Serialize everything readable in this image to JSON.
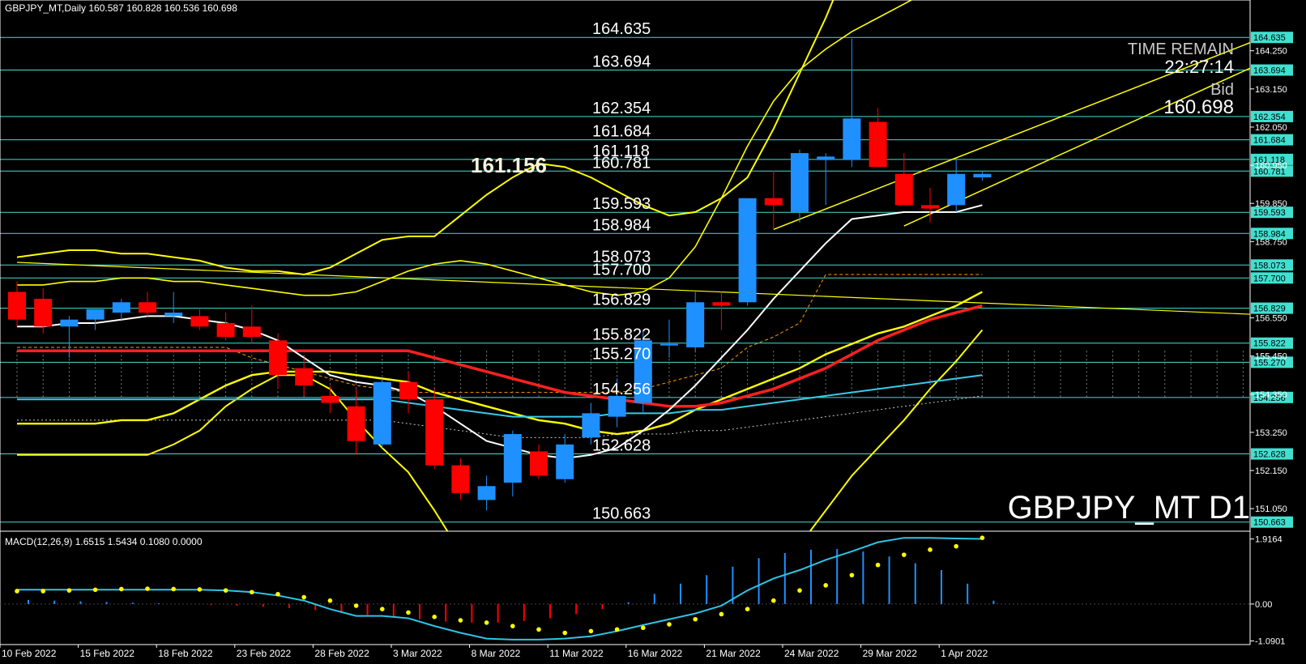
{
  "header": {
    "symbol_info": "GBPJPY_MT,Daily  160.587 160.828 160.536 160.698"
  },
  "watermark": "GBPJPY_MT D1",
  "timer": {
    "title": "TIME REMAIN",
    "value": "22:27:14",
    "bid_label": "Bid",
    "bid_value": "160.698"
  },
  "big_label": "161.156",
  "macd_label": "MACD(12,26,9) 1.6515 1.5434 0.1080 0.0000",
  "colors": {
    "up": "#1e90ff",
    "down": "#ff0000",
    "level": "#40e0d0",
    "band": "#ffff00",
    "ma_red": "#ff2020",
    "ma_white": "#ffffff",
    "macd_line": "#2ec4e6",
    "signal": "#ffff00"
  },
  "chart_data": {
    "type": "candlestick",
    "title": "GBPJPY_MT,Daily",
    "ylim": [
      150.4,
      165.2
    ],
    "macd_ylim": [
      -1.1,
      2.05
    ],
    "x_labels": [
      "10 Feb 2022",
      "15 Feb 2022",
      "18 Feb 2022",
      "23 Feb 2022",
      "28 Feb 2022",
      "3 Mar 2022",
      "8 Mar 2022",
      "11 Mar 2022",
      "16 Mar 2022",
      "21 Mar 2022",
      "24 Mar 2022",
      "29 Mar 2022",
      "1 Apr 2022"
    ],
    "x_label_index": [
      0,
      3,
      6,
      9,
      12,
      15,
      18,
      21,
      24,
      27,
      30,
      33,
      36
    ],
    "y_axis_labels": [
      "164.250",
      "163.150",
      "162.050",
      "160.950",
      "159.850",
      "158.750",
      "156.550",
      "155.450",
      "154.350",
      "153.250",
      "152.150",
      "151.050"
    ],
    "macd_axis_labels": [
      "1.9164",
      "0.00",
      "-1.0901"
    ],
    "levels": [
      {
        "value": 164.635,
        "label": "164.635"
      },
      {
        "value": 163.694,
        "label": "163.694"
      },
      {
        "value": 162.354,
        "label": "162.354"
      },
      {
        "value": 161.684,
        "label": "161.684"
      },
      {
        "value": 161.118,
        "label": "161.118"
      },
      {
        "value": 160.781,
        "label": "160.781"
      },
      {
        "value": 159.593,
        "label": "159.593"
      },
      {
        "value": 158.984,
        "label": "158.984"
      },
      {
        "value": 158.073,
        "label": "158.073"
      },
      {
        "value": 157.7,
        "label": "157.700"
      },
      {
        "value": 156.829,
        "label": "156.829"
      },
      {
        "value": 155.822,
        "label": "155.822"
      },
      {
        "value": 155.27,
        "label": "155.270"
      },
      {
        "value": 154.256,
        "label": "154.256"
      },
      {
        "value": 152.628,
        "label": "152.628"
      },
      {
        "value": 150.663,
        "label": "150.663"
      }
    ],
    "candles": [
      [
        157.3,
        157.6,
        156.3,
        156.5
      ],
      [
        157.1,
        157.4,
        156.1,
        156.3
      ],
      [
        156.3,
        156.6,
        155.4,
        156.5
      ],
      [
        156.5,
        156.8,
        156.2,
        156.8
      ],
      [
        156.7,
        157.1,
        156.5,
        157.0
      ],
      [
        157.0,
        157.3,
        156.6,
        156.7
      ],
      [
        156.6,
        157.3,
        156.4,
        156.7
      ],
      [
        156.6,
        156.8,
        156.2,
        156.3
      ],
      [
        156.4,
        156.7,
        155.9,
        156.0
      ],
      [
        156.3,
        156.9,
        155.8,
        156.0
      ],
      [
        155.9,
        156.1,
        154.5,
        154.9
      ],
      [
        155.1,
        155.4,
        154.3,
        154.6
      ],
      [
        154.3,
        154.6,
        153.8,
        154.1
      ],
      [
        154.0,
        154.5,
        152.6,
        153.0
      ],
      [
        152.9,
        154.8,
        152.8,
        154.7
      ],
      [
        154.7,
        155.0,
        153.8,
        154.2
      ],
      [
        154.2,
        154.5,
        152.2,
        152.3
      ],
      [
        152.3,
        152.5,
        151.3,
        151.5
      ],
      [
        151.3,
        152.0,
        151.0,
        151.7
      ],
      [
        151.8,
        153.3,
        151.4,
        153.2
      ],
      [
        152.7,
        152.9,
        151.9,
        152.0
      ],
      [
        151.9,
        153.2,
        151.8,
        152.9
      ],
      [
        153.1,
        154.1,
        152.9,
        153.8
      ],
      [
        153.7,
        154.8,
        153.4,
        154.3
      ],
      [
        154.1,
        156.2,
        153.8,
        155.9
      ],
      [
        155.8,
        156.5,
        155.4,
        155.8
      ],
      [
        155.7,
        157.3,
        155.6,
        157.0
      ],
      [
        157.0,
        157.3,
        156.2,
        156.9
      ],
      [
        157.0,
        160.0,
        156.9,
        160.0
      ],
      [
        160.0,
        160.8,
        159.1,
        159.8
      ],
      [
        159.6,
        161.4,
        159.3,
        161.3
      ],
      [
        161.1,
        161.3,
        159.8,
        161.2
      ],
      [
        161.1,
        164.6,
        160.9,
        162.3
      ],
      [
        162.2,
        162.6,
        160.9,
        160.9
      ],
      [
        160.7,
        161.3,
        159.9,
        159.8
      ],
      [
        159.8,
        160.3,
        159.3,
        159.7
      ],
      [
        159.8,
        161.1,
        159.6,
        160.7
      ],
      [
        160.6,
        160.8,
        160.5,
        160.7
      ]
    ],
    "ma_white": [
      156.3,
      156.3,
      156.4,
      156.4,
      156.5,
      156.6,
      156.6,
      156.5,
      156.4,
      156.2,
      155.9,
      155.4,
      154.9,
      154.7,
      154.6,
      154.4,
      154.0,
      153.5,
      153.0,
      152.8,
      152.6,
      152.5,
      152.6,
      152.8,
      153.3,
      153.9,
      154.6,
      155.4,
      156.2,
      157.1,
      157.9,
      158.7,
      159.4,
      159.5,
      159.6,
      159.6,
      159.6,
      159.8
    ],
    "ma_red": [
      155.6,
      155.6,
      155.6,
      155.6,
      155.6,
      155.6,
      155.6,
      155.6,
      155.6,
      155.6,
      155.6,
      155.6,
      155.6,
      155.6,
      155.6,
      155.6,
      155.4,
      155.2,
      155.0,
      154.8,
      154.6,
      154.4,
      154.3,
      154.2,
      154.1,
      154.0,
      154.0,
      154.1,
      154.3,
      154.5,
      154.8,
      155.1,
      155.5,
      155.9,
      156.2,
      156.5,
      156.7,
      156.9
    ],
    "ma_teal": [
      154.2,
      154.2,
      154.2,
      154.2,
      154.2,
      154.2,
      154.2,
      154.2,
      154.2,
      154.2,
      154.2,
      154.2,
      154.2,
      154.2,
      154.2,
      154.1,
      154.0,
      153.9,
      153.8,
      153.7,
      153.7,
      153.7,
      153.7,
      153.8,
      153.8,
      153.8,
      153.9,
      153.9,
      154.0,
      154.1,
      154.2,
      154.3,
      154.4,
      154.5,
      154.6,
      154.7,
      154.8,
      154.9
    ],
    "bb_mid": [
      153.5,
      153.5,
      153.5,
      153.5,
      153.6,
      153.6,
      153.8,
      154.2,
      154.6,
      154.9,
      155.0,
      155.0,
      155.0,
      154.9,
      154.8,
      154.7,
      154.4,
      154.2,
      154.0,
      153.8,
      153.6,
      153.5,
      153.3,
      153.2,
      153.3,
      153.5,
      153.9,
      154.2,
      154.5,
      154.8,
      155.1,
      155.5,
      155.8,
      156.1,
      156.3,
      156.6,
      156.9,
      157.3
    ],
    "bb_upper": [
      158.3,
      158.4,
      158.5,
      158.5,
      158.4,
      158.4,
      158.3,
      158.2,
      158.0,
      157.9,
      157.9,
      157.8,
      158.0,
      158.4,
      158.8,
      158.9,
      158.9,
      159.5,
      160.1,
      160.6,
      161.0,
      160.9,
      160.6,
      160.2,
      159.8,
      159.5,
      159.6,
      160.0,
      160.6,
      162.0,
      163.6,
      165.2,
      167.0,
      168.5,
      170.0,
      171.5,
      173.0,
      174.5
    ],
    "bb_lower": [
      152.6,
      152.6,
      152.6,
      152.6,
      152.6,
      152.6,
      152.9,
      153.3,
      154.0,
      154.5,
      154.9,
      154.9,
      154.5,
      153.6,
      152.8,
      152.1,
      151.0,
      149.8,
      148.8,
      148.0,
      147.5,
      147.2,
      147.1,
      147.1,
      147.2,
      147.4,
      147.7,
      148.0,
      148.6,
      149.3,
      150.0,
      151.0,
      152.0,
      152.8,
      153.6,
      154.5,
      155.3,
      156.2
    ],
    "bb2_upper": [
      157.5,
      157.5,
      157.6,
      157.6,
      157.7,
      157.7,
      157.6,
      157.6,
      157.5,
      157.4,
      157.3,
      157.2,
      157.2,
      157.3,
      157.6,
      157.9,
      158.1,
      158.2,
      158.1,
      157.9,
      157.7,
      157.5,
      157.3,
      157.2,
      157.3,
      157.7,
      158.6,
      160.0,
      161.5,
      162.8,
      163.7,
      164.3,
      164.8,
      165.2,
      165.6,
      166.0,
      166.4,
      166.7
    ],
    "ichimoku_kijun": [
      155.7,
      155.7,
      155.7,
      155.7,
      155.7,
      155.7,
      155.7,
      155.7,
      155.7,
      155.4,
      155.2,
      155.0,
      154.8,
      154.6,
      154.5,
      154.4,
      154.4,
      154.4,
      154.4,
      154.4,
      154.4,
      154.4,
      154.4,
      154.4,
      154.5,
      154.7,
      154.9,
      155.1,
      155.7,
      156.0,
      156.4,
      157.8,
      157.8,
      157.8,
      157.8,
      157.8,
      157.8,
      157.8
    ],
    "trend_line": {
      "from": [
        0,
        158.15
      ],
      "to": [
        49,
        156.6
      ]
    },
    "channel_upper": {
      "from": [
        29,
        159.1
      ],
      "to": [
        48,
        164.7
      ]
    },
    "channel_lower": {
      "from": [
        34,
        159.2
      ],
      "to": [
        48,
        164.0
      ]
    },
    "macd_hist": [
      0.12,
      0.1,
      0.08,
      0.06,
      0.04,
      0.02,
      0.0,
      -0.03,
      -0.05,
      -0.08,
      -0.12,
      -0.18,
      -0.25,
      -0.32,
      -0.38,
      -0.45,
      -0.52,
      -0.55,
      -0.55,
      -0.5,
      -0.42,
      -0.3,
      -0.15,
      0.05,
      0.3,
      0.6,
      0.85,
      1.1,
      1.35,
      1.5,
      1.6,
      1.62,
      1.55,
      1.4,
      1.2,
      1.0,
      0.6,
      0.1
    ],
    "macd_line": [
      0.42,
      0.42,
      0.42,
      0.42,
      0.42,
      0.42,
      0.42,
      0.42,
      0.4,
      0.35,
      0.25,
      0.1,
      -0.15,
      -0.35,
      -0.35,
      -0.42,
      -0.65,
      -0.85,
      -1.02,
      -1.05,
      -1.05,
      -1.02,
      -0.95,
      -0.8,
      -0.62,
      -0.45,
      -0.28,
      -0.05,
      0.4,
      0.75,
      1.0,
      1.3,
      1.55,
      1.82,
      1.95,
      1.95,
      1.93,
      1.92
    ],
    "macd_signal": [
      0.38,
      0.38,
      0.4,
      0.42,
      0.44,
      0.45,
      0.44,
      0.43,
      0.4,
      0.35,
      0.29,
      0.2,
      0.1,
      -0.05,
      -0.15,
      -0.25,
      -0.38,
      -0.48,
      -0.55,
      -0.65,
      -0.75,
      -0.85,
      -0.8,
      -0.75,
      -0.7,
      -0.6,
      -0.45,
      -0.3,
      -0.15,
      0.1,
      0.4,
      0.55,
      0.85,
      1.15,
      1.45,
      1.6,
      1.7,
      1.95
    ]
  }
}
